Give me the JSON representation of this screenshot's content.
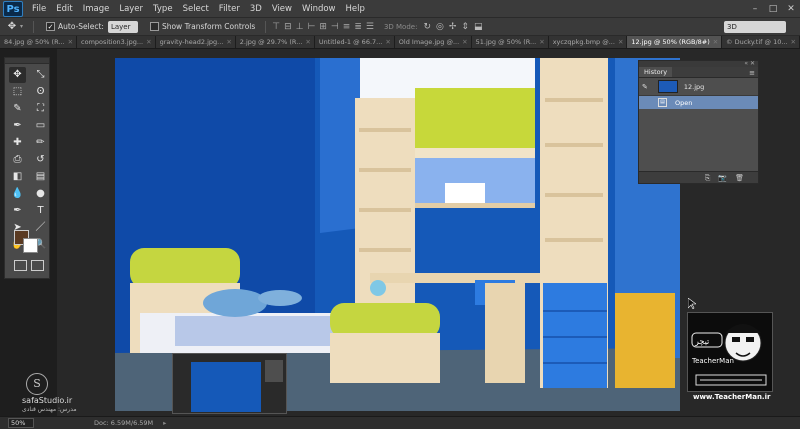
{
  "app": {
    "logo": "Ps"
  },
  "menu": [
    "File",
    "Edit",
    "Image",
    "Layer",
    "Type",
    "Select",
    "Filter",
    "3D",
    "View",
    "Window",
    "Help"
  ],
  "window_controls": {
    "minimize": "–",
    "maximize": "□",
    "close": "✕"
  },
  "options": {
    "move_icon": "move-icon",
    "auto_select_checked": true,
    "auto_select_label": "Auto-Select:",
    "auto_select_value": "Layer",
    "transform_controls_checked": false,
    "transform_controls_label": "Show Transform Controls",
    "mode_3d_label": "3D Mode:",
    "workspace": "3D"
  },
  "tabs": [
    {
      "label": "84.jpg @ 50% (R...",
      "active": false
    },
    {
      "label": "composition3.jpg...",
      "active": false
    },
    {
      "label": "gravity-head2.jpg...",
      "active": false
    },
    {
      "label": "2.jpg @ 29.7% (R...",
      "active": false
    },
    {
      "label": "Untitled-1 @ 66.7...",
      "active": false
    },
    {
      "label": "Old Image.jpg @...",
      "active": false
    },
    {
      "label": "51.jpg @ 50% (R...",
      "active": false
    },
    {
      "label": "xyczqpkg.bmp @...",
      "active": false
    },
    {
      "label": "12.jpg @ 50% (RGB/8#)",
      "active": true
    },
    {
      "label": "© Ducky.tif @ 10...",
      "active": false
    }
  ],
  "tools": [
    "move",
    "artboard",
    "marquee",
    "lasso",
    "quick-select",
    "crop",
    "eyedropper",
    "frame",
    "healing",
    "brush",
    "stamp",
    "history-brush",
    "eraser",
    "gradient",
    "blur",
    "dodge",
    "pen",
    "type",
    "path-select",
    "line",
    "hand",
    "zoom"
  ],
  "tool_glyphs": [
    "✥",
    "⤡",
    "⬚",
    "ʘ",
    "✎",
    "⛶",
    "✒",
    "▭",
    "✚",
    "✏",
    "⎙",
    "↺",
    "◧",
    "▤",
    "💧",
    "●",
    "✒",
    "T",
    "➤",
    "／",
    "✋",
    "🔍"
  ],
  "colors": {
    "foreground": "#5a3a22",
    "background": "#ffffff",
    "wall_blue": "#1559b8"
  },
  "history": {
    "title": "History",
    "menu_icon": "≡",
    "snapshot": "12.jpg",
    "states": [
      {
        "label": "Open",
        "selected": true
      }
    ],
    "footer_icons": [
      "⎘",
      "📷",
      "🗑"
    ]
  },
  "status": {
    "zoom": "50%",
    "doc": "Doc: 6.59M/6.59M"
  },
  "watermarks": {
    "left_logo": "S",
    "left_brand": "safaStudio.ir",
    "left_credit": "مدرس: مهندس قنادی",
    "right_url": "www.TeacherMan.ir",
    "right_logo_text": "TeacherMan"
  }
}
